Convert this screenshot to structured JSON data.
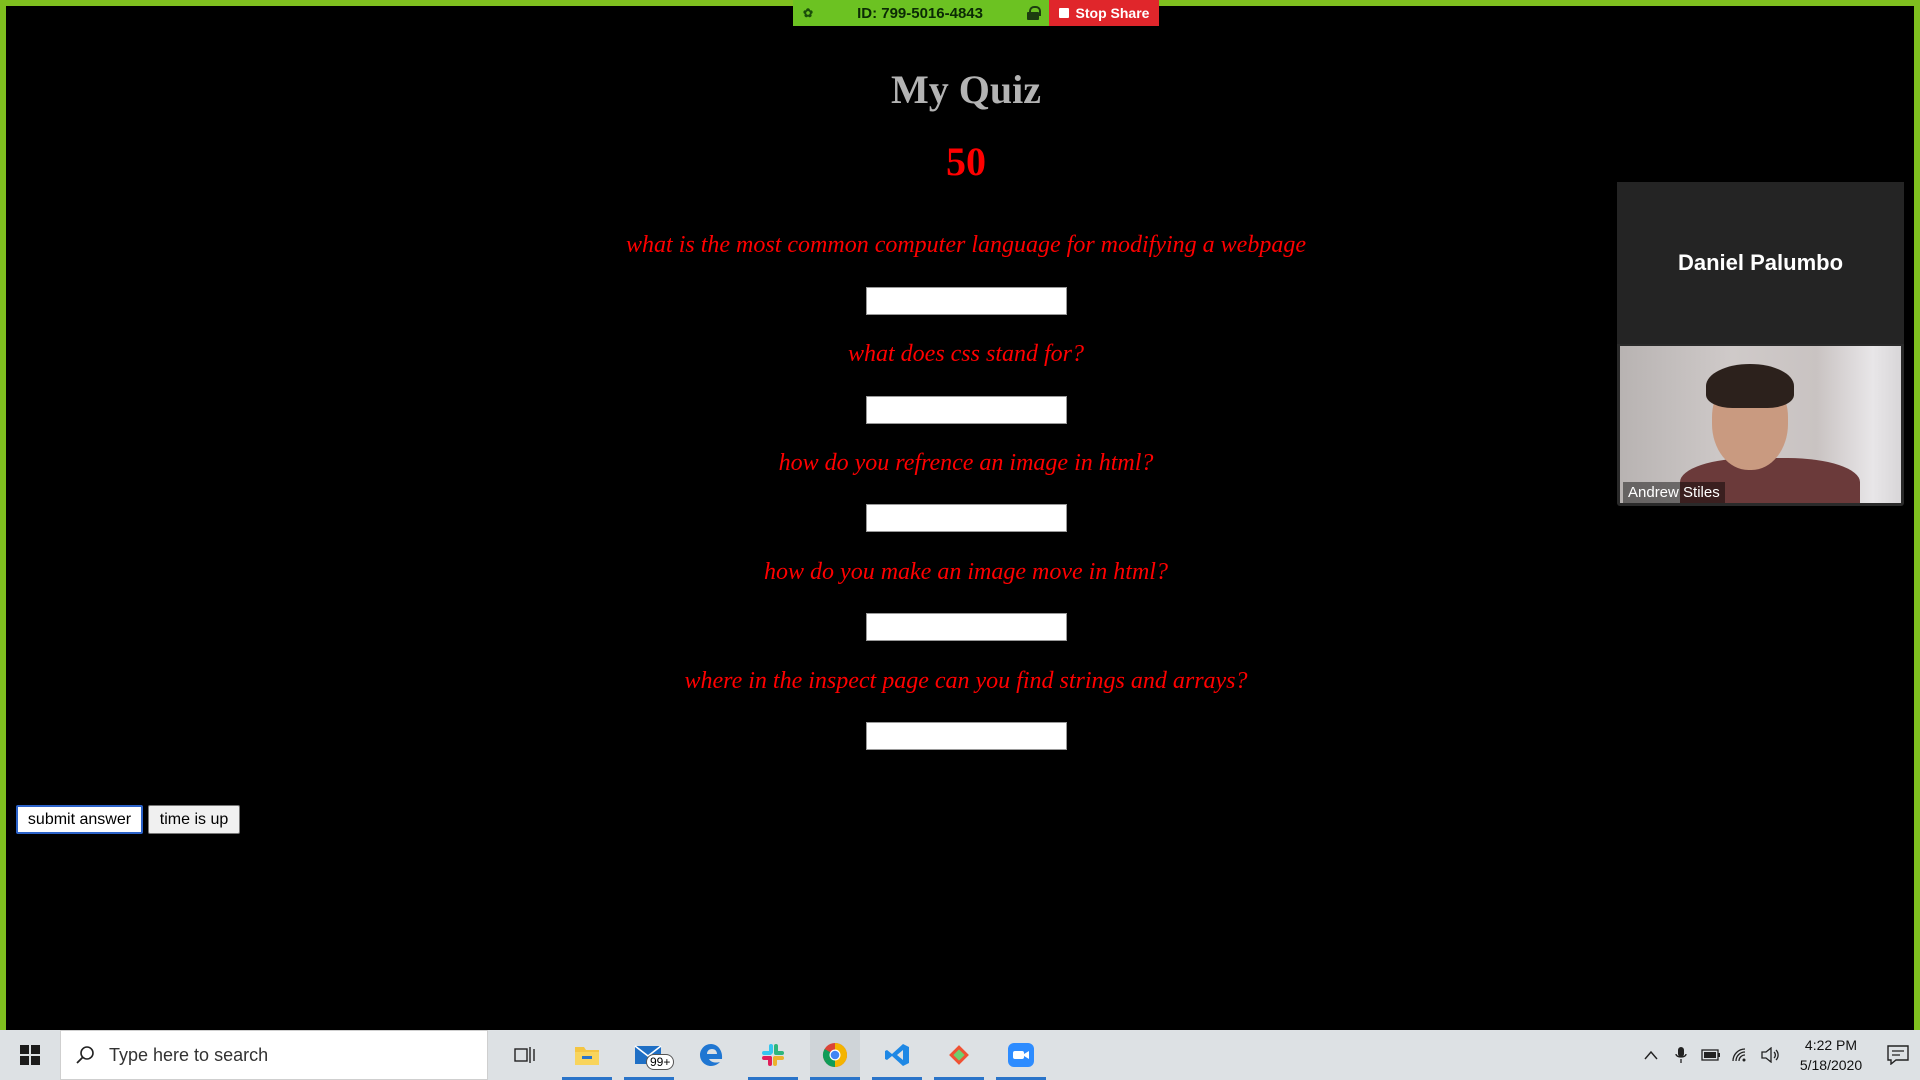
{
  "share_bar": {
    "meeting_id": "ID: 799-5016-4843",
    "stop_label": "Stop Share",
    "icons": [
      "leaf-icon",
      "lock-icon",
      "stop-square-icon"
    ],
    "stop_color": "#e0262b",
    "bar_color": "#6cc222"
  },
  "quiz": {
    "title": "My Quiz",
    "score": "50",
    "questions": [
      {
        "text": "what is the most common computer language for modifying a webpage",
        "answer": ""
      },
      {
        "text": "what does css stand for?",
        "answer": ""
      },
      {
        "text": "how do you refrence an image in html?",
        "answer": ""
      },
      {
        "text": "how do you make an image move in html?",
        "answer": ""
      },
      {
        "text": "where in the inspect page can you find strings and arrays?",
        "answer": ""
      }
    ],
    "submit_label": "submit answer",
    "timeup_label": "time is up",
    "text_color": "#ff0000",
    "title_color": "#b3b3b3"
  },
  "video": {
    "host_name": "Daniel Palumbo",
    "participant_name": "Andrew Stiles"
  },
  "taskbar": {
    "search_placeholder": "Type here to search",
    "mail_badge": "99+",
    "apps": [
      "task-view-icon",
      "file-explorer-icon",
      "mail-icon",
      "edge-icon",
      "slack-icon",
      "chrome-icon",
      "vscode-icon",
      "git-icon",
      "zoom-icon"
    ],
    "time": "4:22 PM",
    "date": "5/18/2020"
  }
}
